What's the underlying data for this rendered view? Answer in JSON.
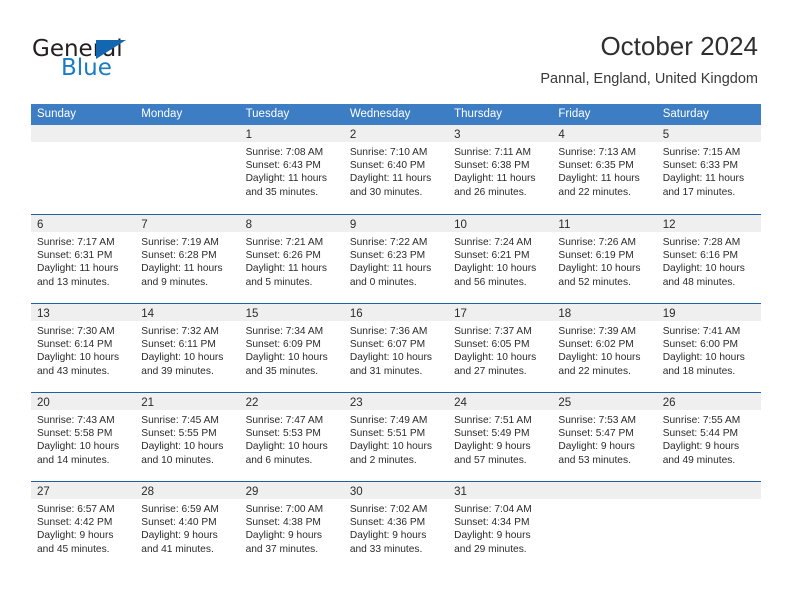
{
  "brand": {
    "name_top": "General",
    "name_bottom": "Blue",
    "accent_color": "#1a7cc4",
    "triangle_color": "#1367b0"
  },
  "header": {
    "title": "October 2024",
    "subtitle": "Pannal, England, United Kingdom"
  },
  "theme": {
    "header_row_bg": "#3c7dc4",
    "week_divider": "#1f5fa3",
    "day_band_bg": "#efefef",
    "text": "#2b2b2b"
  },
  "weekdays": [
    "Sunday",
    "Monday",
    "Tuesday",
    "Wednesday",
    "Thursday",
    "Friday",
    "Saturday"
  ],
  "weeks": [
    [
      {
        "day": "",
        "sunrise": "",
        "sunset": "",
        "daylight_line1": "",
        "daylight_line2": ""
      },
      {
        "day": "",
        "sunrise": "",
        "sunset": "",
        "daylight_line1": "",
        "daylight_line2": ""
      },
      {
        "day": "1",
        "sunrise": "Sunrise: 7:08 AM",
        "sunset": "Sunset: 6:43 PM",
        "daylight_line1": "Daylight: 11 hours",
        "daylight_line2": "and 35 minutes."
      },
      {
        "day": "2",
        "sunrise": "Sunrise: 7:10 AM",
        "sunset": "Sunset: 6:40 PM",
        "daylight_line1": "Daylight: 11 hours",
        "daylight_line2": "and 30 minutes."
      },
      {
        "day": "3",
        "sunrise": "Sunrise: 7:11 AM",
        "sunset": "Sunset: 6:38 PM",
        "daylight_line1": "Daylight: 11 hours",
        "daylight_line2": "and 26 minutes."
      },
      {
        "day": "4",
        "sunrise": "Sunrise: 7:13 AM",
        "sunset": "Sunset: 6:35 PM",
        "daylight_line1": "Daylight: 11 hours",
        "daylight_line2": "and 22 minutes."
      },
      {
        "day": "5",
        "sunrise": "Sunrise: 7:15 AM",
        "sunset": "Sunset: 6:33 PM",
        "daylight_line1": "Daylight: 11 hours",
        "daylight_line2": "and 17 minutes."
      }
    ],
    [
      {
        "day": "6",
        "sunrise": "Sunrise: 7:17 AM",
        "sunset": "Sunset: 6:31 PM",
        "daylight_line1": "Daylight: 11 hours",
        "daylight_line2": "and 13 minutes."
      },
      {
        "day": "7",
        "sunrise": "Sunrise: 7:19 AM",
        "sunset": "Sunset: 6:28 PM",
        "daylight_line1": "Daylight: 11 hours",
        "daylight_line2": "and 9 minutes."
      },
      {
        "day": "8",
        "sunrise": "Sunrise: 7:21 AM",
        "sunset": "Sunset: 6:26 PM",
        "daylight_line1": "Daylight: 11 hours",
        "daylight_line2": "and 5 minutes."
      },
      {
        "day": "9",
        "sunrise": "Sunrise: 7:22 AM",
        "sunset": "Sunset: 6:23 PM",
        "daylight_line1": "Daylight: 11 hours",
        "daylight_line2": "and 0 minutes."
      },
      {
        "day": "10",
        "sunrise": "Sunrise: 7:24 AM",
        "sunset": "Sunset: 6:21 PM",
        "daylight_line1": "Daylight: 10 hours",
        "daylight_line2": "and 56 minutes."
      },
      {
        "day": "11",
        "sunrise": "Sunrise: 7:26 AM",
        "sunset": "Sunset: 6:19 PM",
        "daylight_line1": "Daylight: 10 hours",
        "daylight_line2": "and 52 minutes."
      },
      {
        "day": "12",
        "sunrise": "Sunrise: 7:28 AM",
        "sunset": "Sunset: 6:16 PM",
        "daylight_line1": "Daylight: 10 hours",
        "daylight_line2": "and 48 minutes."
      }
    ],
    [
      {
        "day": "13",
        "sunrise": "Sunrise: 7:30 AM",
        "sunset": "Sunset: 6:14 PM",
        "daylight_line1": "Daylight: 10 hours",
        "daylight_line2": "and 43 minutes."
      },
      {
        "day": "14",
        "sunrise": "Sunrise: 7:32 AM",
        "sunset": "Sunset: 6:11 PM",
        "daylight_line1": "Daylight: 10 hours",
        "daylight_line2": "and 39 minutes."
      },
      {
        "day": "15",
        "sunrise": "Sunrise: 7:34 AM",
        "sunset": "Sunset: 6:09 PM",
        "daylight_line1": "Daylight: 10 hours",
        "daylight_line2": "and 35 minutes."
      },
      {
        "day": "16",
        "sunrise": "Sunrise: 7:36 AM",
        "sunset": "Sunset: 6:07 PM",
        "daylight_line1": "Daylight: 10 hours",
        "daylight_line2": "and 31 minutes."
      },
      {
        "day": "17",
        "sunrise": "Sunrise: 7:37 AM",
        "sunset": "Sunset: 6:05 PM",
        "daylight_line1": "Daylight: 10 hours",
        "daylight_line2": "and 27 minutes."
      },
      {
        "day": "18",
        "sunrise": "Sunrise: 7:39 AM",
        "sunset": "Sunset: 6:02 PM",
        "daylight_line1": "Daylight: 10 hours",
        "daylight_line2": "and 22 minutes."
      },
      {
        "day": "19",
        "sunrise": "Sunrise: 7:41 AM",
        "sunset": "Sunset: 6:00 PM",
        "daylight_line1": "Daylight: 10 hours",
        "daylight_line2": "and 18 minutes."
      }
    ],
    [
      {
        "day": "20",
        "sunrise": "Sunrise: 7:43 AM",
        "sunset": "Sunset: 5:58 PM",
        "daylight_line1": "Daylight: 10 hours",
        "daylight_line2": "and 14 minutes."
      },
      {
        "day": "21",
        "sunrise": "Sunrise: 7:45 AM",
        "sunset": "Sunset: 5:55 PM",
        "daylight_line1": "Daylight: 10 hours",
        "daylight_line2": "and 10 minutes."
      },
      {
        "day": "22",
        "sunrise": "Sunrise: 7:47 AM",
        "sunset": "Sunset: 5:53 PM",
        "daylight_line1": "Daylight: 10 hours",
        "daylight_line2": "and 6 minutes."
      },
      {
        "day": "23",
        "sunrise": "Sunrise: 7:49 AM",
        "sunset": "Sunset: 5:51 PM",
        "daylight_line1": "Daylight: 10 hours",
        "daylight_line2": "and 2 minutes."
      },
      {
        "day": "24",
        "sunrise": "Sunrise: 7:51 AM",
        "sunset": "Sunset: 5:49 PM",
        "daylight_line1": "Daylight: 9 hours",
        "daylight_line2": "and 57 minutes."
      },
      {
        "day": "25",
        "sunrise": "Sunrise: 7:53 AM",
        "sunset": "Sunset: 5:47 PM",
        "daylight_line1": "Daylight: 9 hours",
        "daylight_line2": "and 53 minutes."
      },
      {
        "day": "26",
        "sunrise": "Sunrise: 7:55 AM",
        "sunset": "Sunset: 5:44 PM",
        "daylight_line1": "Daylight: 9 hours",
        "daylight_line2": "and 49 minutes."
      }
    ],
    [
      {
        "day": "27",
        "sunrise": "Sunrise: 6:57 AM",
        "sunset": "Sunset: 4:42 PM",
        "daylight_line1": "Daylight: 9 hours",
        "daylight_line2": "and 45 minutes."
      },
      {
        "day": "28",
        "sunrise": "Sunrise: 6:59 AM",
        "sunset": "Sunset: 4:40 PM",
        "daylight_line1": "Daylight: 9 hours",
        "daylight_line2": "and 41 minutes."
      },
      {
        "day": "29",
        "sunrise": "Sunrise: 7:00 AM",
        "sunset": "Sunset: 4:38 PM",
        "daylight_line1": "Daylight: 9 hours",
        "daylight_line2": "and 37 minutes."
      },
      {
        "day": "30",
        "sunrise": "Sunrise: 7:02 AM",
        "sunset": "Sunset: 4:36 PM",
        "daylight_line1": "Daylight: 9 hours",
        "daylight_line2": "and 33 minutes."
      },
      {
        "day": "31",
        "sunrise": "Sunrise: 7:04 AM",
        "sunset": "Sunset: 4:34 PM",
        "daylight_line1": "Daylight: 9 hours",
        "daylight_line2": "and 29 minutes."
      },
      {
        "day": "",
        "sunrise": "",
        "sunset": "",
        "daylight_line1": "",
        "daylight_line2": ""
      },
      {
        "day": "",
        "sunrise": "",
        "sunset": "",
        "daylight_line1": "",
        "daylight_line2": ""
      }
    ]
  ]
}
